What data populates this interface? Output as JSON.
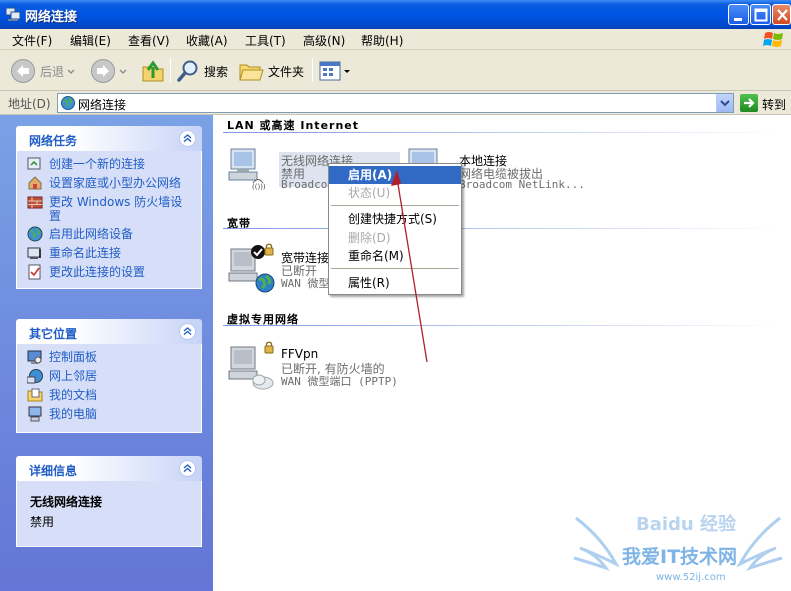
{
  "window": {
    "title": "网络连接"
  },
  "menu": [
    "文件(F)",
    "编辑(E)",
    "查看(V)",
    "收藏(A)",
    "工具(T)",
    "高级(N)",
    "帮助(H)"
  ],
  "toolbar": {
    "back": "后退",
    "search": "搜索",
    "folders": "文件夹"
  },
  "address": {
    "label": "地址(D)",
    "value": "网络连接",
    "go": "转到"
  },
  "left": {
    "network_tasks": {
      "title": "网络任务",
      "items": [
        "创建一个新的连接",
        "设置家庭或小型办公网络",
        "更改 Windows 防火墙设置",
        "启用此网络设备",
        "重命名此连接",
        "更改此连接的设置"
      ]
    },
    "other_places": {
      "title": "其它位置",
      "items": [
        "控制面板",
        "网上邻居",
        "我的文档",
        "我的电脑"
      ]
    },
    "details": {
      "title": "详细信息",
      "name": "无线网络连接",
      "status": "禁用"
    }
  },
  "groups": {
    "lan": "LAN 或高速 Internet",
    "broadband": "宽带",
    "vpn": "虚拟专用网络"
  },
  "connections": {
    "wireless": {
      "title": "无线网络连接",
      "status": "禁用",
      "device": "Broadcom"
    },
    "local": {
      "title": "本地连接",
      "status": "网络电缆被拔出",
      "device": "Broadcom NetLink..."
    },
    "broadband": {
      "title": "宽带连接",
      "status": "已断开",
      "device": "WAN 微型"
    },
    "vpn": {
      "title": "FFVpn",
      "status": "已断开, 有防火墙的",
      "device": "WAN 微型端口 (PPTP)"
    }
  },
  "context_menu": {
    "enable": "启用(A)",
    "status": "状态(U)",
    "shortcut": "创建快捷方式(S)",
    "delete": "删除(D)",
    "rename": "重命名(M)",
    "properties": "属性(R)"
  },
  "watermark": {
    "brand": "Baidu 经验",
    "site_name": "我爱IT技术网",
    "url": "www.52ij.com"
  },
  "colors": {
    "titlebar": "#0054e3",
    "taskpane": "#6375d6",
    "link": "#215dc6",
    "menu_highlight": "#316ac5",
    "arrow": "#b0202a"
  }
}
